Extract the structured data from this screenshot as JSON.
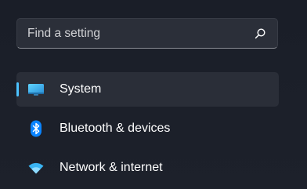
{
  "search": {
    "placeholder": "Find a setting"
  },
  "nav": {
    "items": [
      {
        "label": "System",
        "icon": "display-icon",
        "selected": true
      },
      {
        "label": "Bluetooth & devices",
        "icon": "bluetooth-icon",
        "selected": false
      },
      {
        "label": "Network & internet",
        "icon": "wifi-icon",
        "selected": false
      }
    ]
  },
  "colors": {
    "accent": "#4cc2ff",
    "background": "#1b1f2a",
    "search_background": "#2b2f39",
    "selected_background": "#2a2e38",
    "bluetooth_blue": "#0a84ff",
    "wifi_blue": "#3ab4f2"
  }
}
